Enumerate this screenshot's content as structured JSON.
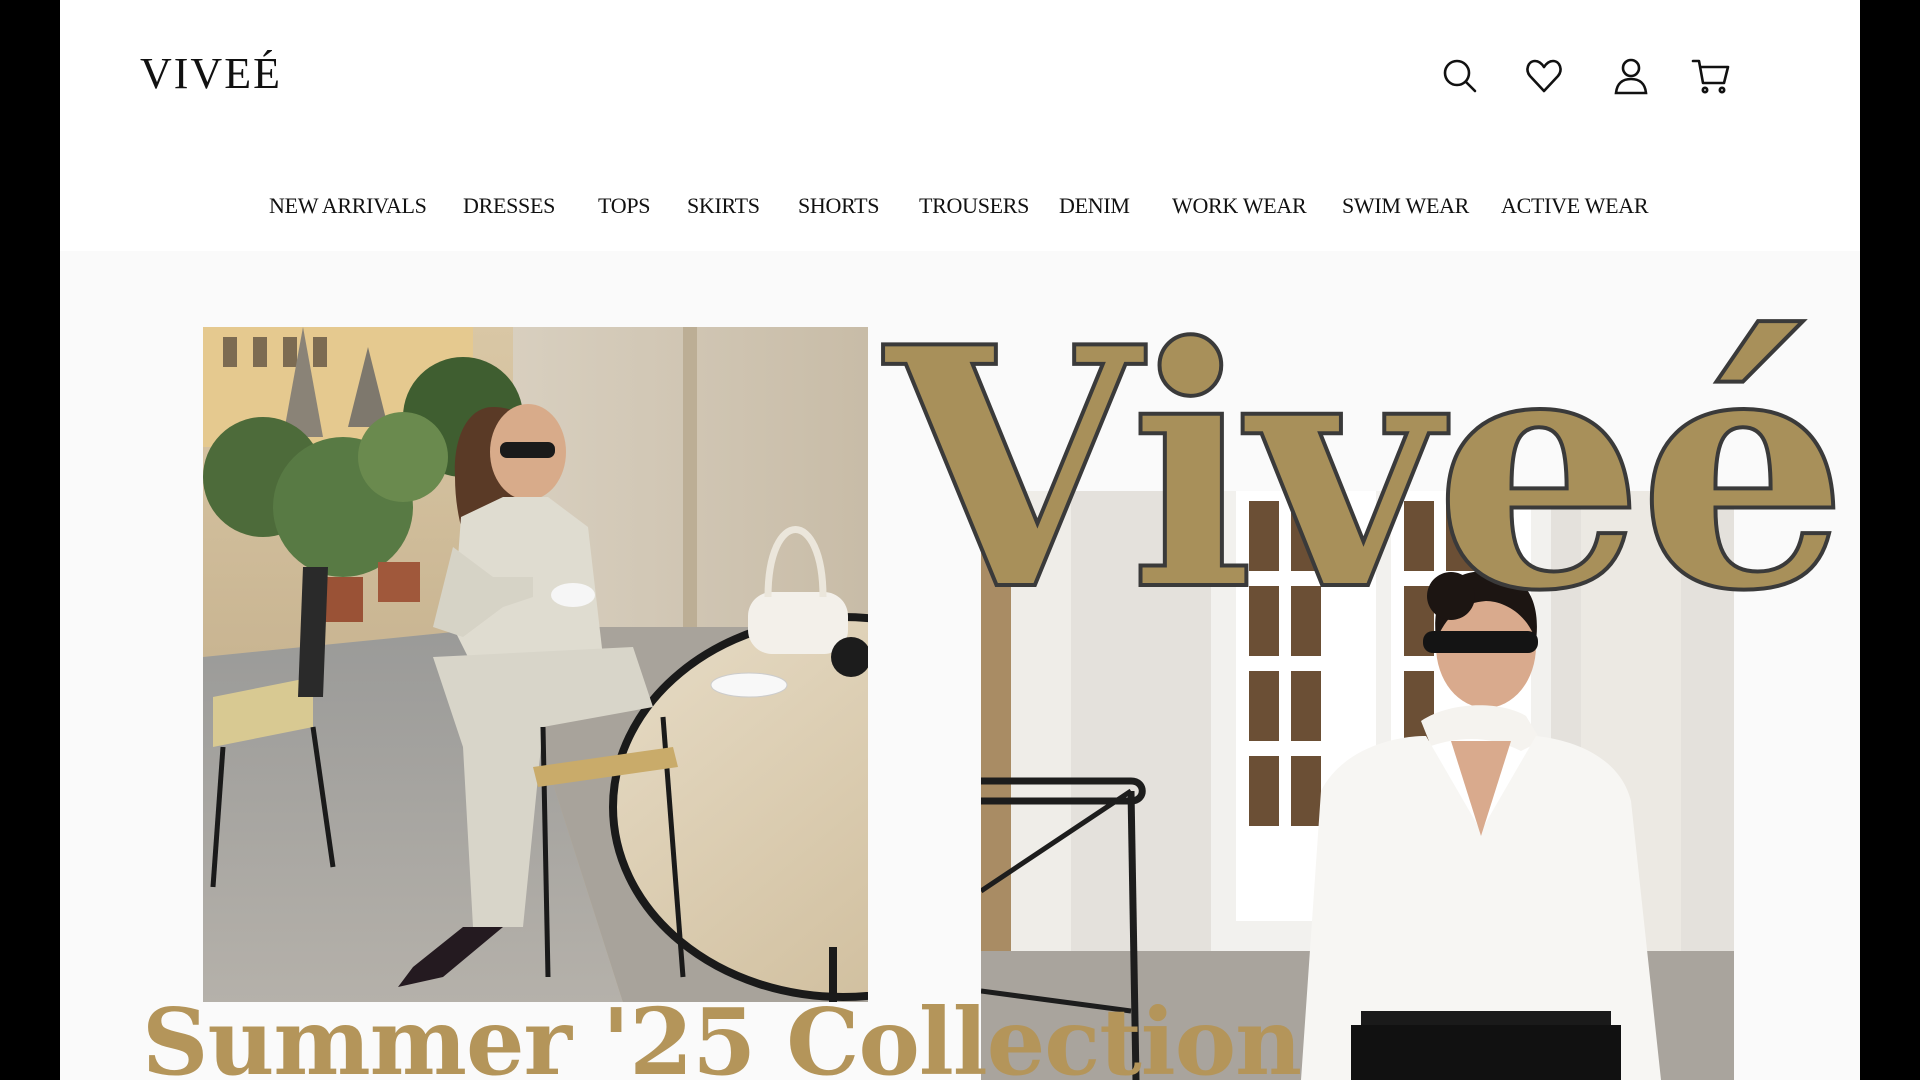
{
  "brand": {
    "logo_text": "VIVEÉ",
    "hero_wordmark": "Viveé",
    "accent_color": "#a8905a"
  },
  "header": {
    "icons": [
      "search-icon",
      "heart-icon",
      "user-icon",
      "cart-icon"
    ]
  },
  "nav": {
    "items": [
      {
        "label": "NEW ARRIVALS"
      },
      {
        "label": "DRESSES"
      },
      {
        "label": "TOPS"
      },
      {
        "label": "SKIRTS"
      },
      {
        "label": "SHORTS"
      },
      {
        "label": "TROUSERS"
      },
      {
        "label": "DENIM"
      },
      {
        "label": "WORK WEAR"
      },
      {
        "label": "SWIM WEAR"
      },
      {
        "label": "ACTIVE WEAR"
      }
    ]
  },
  "hero": {
    "collection_title": "Summer '25 Collection"
  }
}
